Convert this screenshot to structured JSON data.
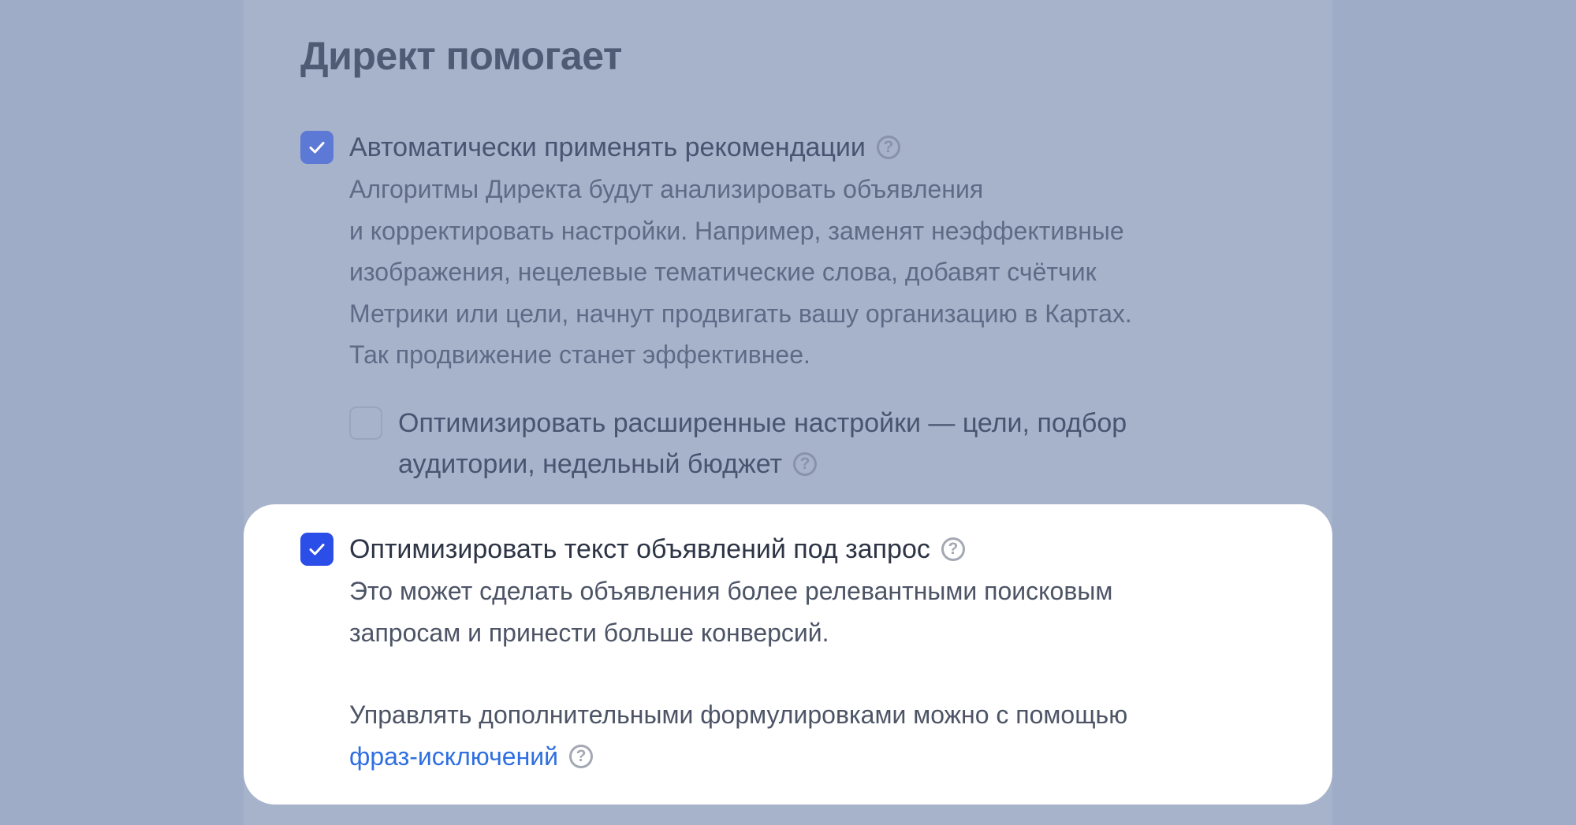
{
  "section": {
    "title": "Директ помогает"
  },
  "options": {
    "auto_recommend": {
      "checked": true,
      "label": "Автоматически применять рекомендации",
      "description": [
        "Алгоритмы Директа будут анализировать объявления",
        "и корректировать настройки. Например, заменят неэффективные",
        "изображения, нецелевые тематические слова, добавят счётчик",
        "Метрики или цели, начнут продвигать вашу организацию в Картах.",
        "Так продвижение станет эффективнее."
      ]
    },
    "advanced": {
      "checked": false,
      "label_line1": "Оптимизировать расширенные настройки — цели, подбор",
      "label_line2": "аудитории, недельный бюджет"
    },
    "optimize_text": {
      "checked": true,
      "label": "Оптимизировать текст объявлений под запрос",
      "description": [
        "Это может сделать объявления более релевантными поисковым",
        "запросам и принести больше конверсий."
      ],
      "manage_text": "Управлять дополнительными формулировками можно с помощью",
      "link_text": "фраз-исключений"
    }
  },
  "icons": {
    "help": "?"
  },
  "colors": {
    "checkbox_active": "#2b4de8",
    "link": "#2f6fe0",
    "overlay": "#9eacc7"
  }
}
